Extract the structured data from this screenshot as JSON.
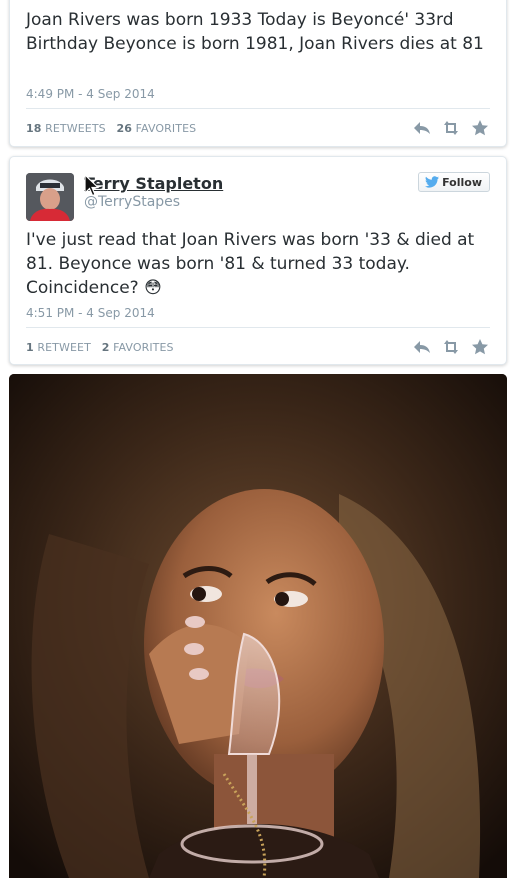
{
  "tweet1": {
    "text": "Joan Rivers was born 1933 Today is Beyoncé' 33rd Birthday Beyonce is born 1981, Joan Rivers dies at 81",
    "timestamp": "4:49 PM - 4 Sep 2014",
    "retweets_count": "18",
    "retweets_label": "RETWEETS",
    "favorites_count": "26",
    "favorites_label": "FAVORITES"
  },
  "tweet2": {
    "author_name": "Terry Stapleton",
    "author_handle": "@TerryStapes",
    "follow_label": "Follow",
    "text": "I've just read that Joan Rivers was born '33 & died at 81. Beyonce was born '81 & turned 33 today. Coincidence? 😳",
    "timestamp": "4:51 PM - 4 Sep 2014",
    "retweets_count": "1",
    "retweets_label": "RETWEET",
    "favorites_count": "2",
    "favorites_label": "FAVORITES"
  },
  "icons": {
    "reply": "reply-icon",
    "retweet": "retweet-icon",
    "favorite": "star-icon",
    "follow_bird": "twitter-bird-icon"
  },
  "colors": {
    "twitter_blue": "#55acee",
    "action_gray": "#8899a6"
  }
}
